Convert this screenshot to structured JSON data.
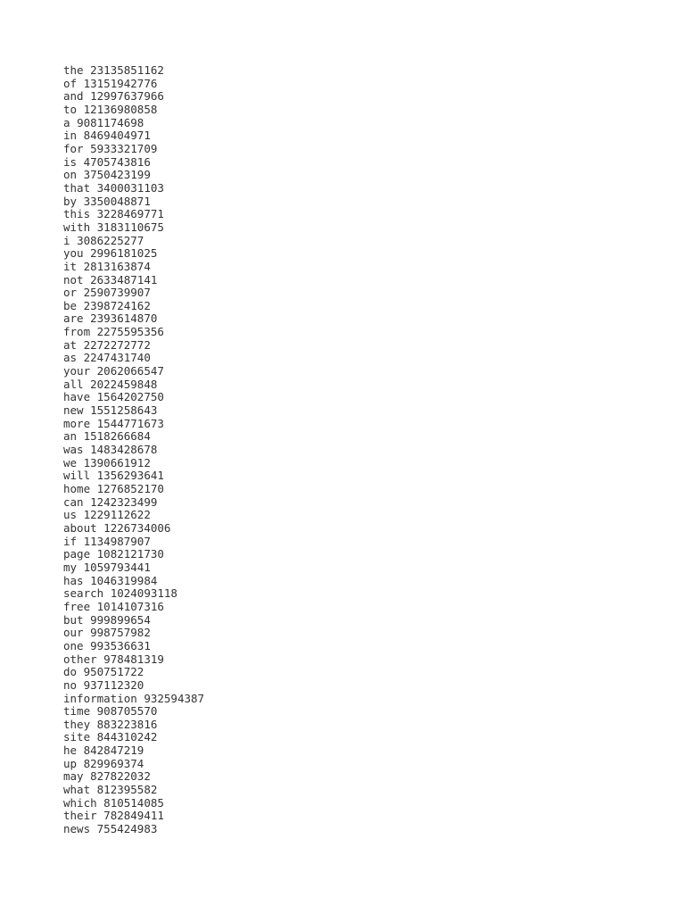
{
  "document": {
    "title": "Word Frequency List",
    "background_color": "#ffffff",
    "text_color": "#333333"
  },
  "word_frequency_list": {
    "separator": " ",
    "entries": [
      {
        "word": "the",
        "count": "23135851162",
        "line": "the 23135851162"
      },
      {
        "word": "of",
        "count": "13151942776",
        "line": "of 13151942776"
      },
      {
        "word": "and",
        "count": "12997637966",
        "line": "and 12997637966"
      },
      {
        "word": "to",
        "count": "12136980858",
        "line": "to 12136980858"
      },
      {
        "word": "a",
        "count": "9081174698",
        "line": "a 9081174698"
      },
      {
        "word": "in",
        "count": "8469404971",
        "line": "in 8469404971"
      },
      {
        "word": "for",
        "count": "5933321709",
        "line": "for 5933321709"
      },
      {
        "word": "is",
        "count": "4705743816",
        "line": "is 4705743816"
      },
      {
        "word": "on",
        "count": "3750423199",
        "line": "on 3750423199"
      },
      {
        "word": "that",
        "count": "3400031103",
        "line": "that 3400031103"
      },
      {
        "word": "by",
        "count": "3350048871",
        "line": "by 3350048871"
      },
      {
        "word": "this",
        "count": "3228469771",
        "line": "this 3228469771"
      },
      {
        "word": "with",
        "count": "3183110675",
        "line": "with 3183110675"
      },
      {
        "word": "i",
        "count": "3086225277",
        "line": "i 3086225277"
      },
      {
        "word": "you",
        "count": "2996181025",
        "line": "you 2996181025"
      },
      {
        "word": "it",
        "count": "2813163874",
        "line": "it 2813163874"
      },
      {
        "word": "not",
        "count": "2633487141",
        "line": "not 2633487141"
      },
      {
        "word": "or",
        "count": "2590739907",
        "line": "or 2590739907"
      },
      {
        "word": "be",
        "count": "2398724162",
        "line": "be 2398724162"
      },
      {
        "word": "are",
        "count": "2393614870",
        "line": "are 2393614870"
      },
      {
        "word": "from",
        "count": "2275595356",
        "line": "from 2275595356"
      },
      {
        "word": "at",
        "count": "2272272772",
        "line": "at 2272272772"
      },
      {
        "word": "as",
        "count": "2247431740",
        "line": "as 2247431740"
      },
      {
        "word": "your",
        "count": "2062066547",
        "line": "your 2062066547"
      },
      {
        "word": "all",
        "count": "2022459848",
        "line": "all 2022459848"
      },
      {
        "word": "have",
        "count": "1564202750",
        "line": "have 1564202750"
      },
      {
        "word": "new",
        "count": "1551258643",
        "line": "new 1551258643"
      },
      {
        "word": "more",
        "count": "1544771673",
        "line": "more 1544771673"
      },
      {
        "word": "an",
        "count": "1518266684",
        "line": "an 1518266684"
      },
      {
        "word": "was",
        "count": "1483428678",
        "line": "was 1483428678"
      },
      {
        "word": "we",
        "count": "1390661912",
        "line": "we 1390661912"
      },
      {
        "word": "will",
        "count": "1356293641",
        "line": "will 1356293641"
      },
      {
        "word": "home",
        "count": "1276852170",
        "line": "home 1276852170"
      },
      {
        "word": "can",
        "count": "1242323499",
        "line": "can 1242323499"
      },
      {
        "word": "us",
        "count": "1229112622",
        "line": "us 1229112622"
      },
      {
        "word": "about",
        "count": "1226734006",
        "line": "about 1226734006"
      },
      {
        "word": "if",
        "count": "1134987907",
        "line": "if 1134987907"
      },
      {
        "word": "page",
        "count": "1082121730",
        "line": "page 1082121730"
      },
      {
        "word": "my",
        "count": "1059793441",
        "line": "my 1059793441"
      },
      {
        "word": "has",
        "count": "1046319984",
        "line": "has 1046319984"
      },
      {
        "word": "search",
        "count": "1024093118",
        "line": "search 1024093118"
      },
      {
        "word": "free",
        "count": "1014107316",
        "line": "free 1014107316"
      },
      {
        "word": "but",
        "count": "999899654",
        "line": "but 999899654"
      },
      {
        "word": "our",
        "count": "998757982",
        "line": "our 998757982"
      },
      {
        "word": "one",
        "count": "993536631",
        "line": "one 993536631"
      },
      {
        "word": "other",
        "count": "978481319",
        "line": "other 978481319"
      },
      {
        "word": "do",
        "count": "950751722",
        "line": "do 950751722"
      },
      {
        "word": "no",
        "count": "937112320",
        "line": "no 937112320"
      },
      {
        "word": "information",
        "count": "932594387",
        "line": "information 932594387"
      },
      {
        "word": "time",
        "count": "908705570",
        "line": "time 908705570"
      },
      {
        "word": "they",
        "count": "883223816",
        "line": "they 883223816"
      },
      {
        "word": "site",
        "count": "844310242",
        "line": "site 844310242"
      },
      {
        "word": "he",
        "count": "842847219",
        "line": "he 842847219"
      },
      {
        "word": "up",
        "count": "829969374",
        "line": "up 829969374"
      },
      {
        "word": "may",
        "count": "827822032",
        "line": "may 827822032"
      },
      {
        "word": "what",
        "count": "812395582",
        "line": "what 812395582"
      },
      {
        "word": "which",
        "count": "810514085",
        "line": "which 810514085"
      },
      {
        "word": "their",
        "count": "782849411",
        "line": "their 782849411"
      },
      {
        "word": "news",
        "count": "755424983",
        "line": "news 755424983"
      }
    ]
  }
}
